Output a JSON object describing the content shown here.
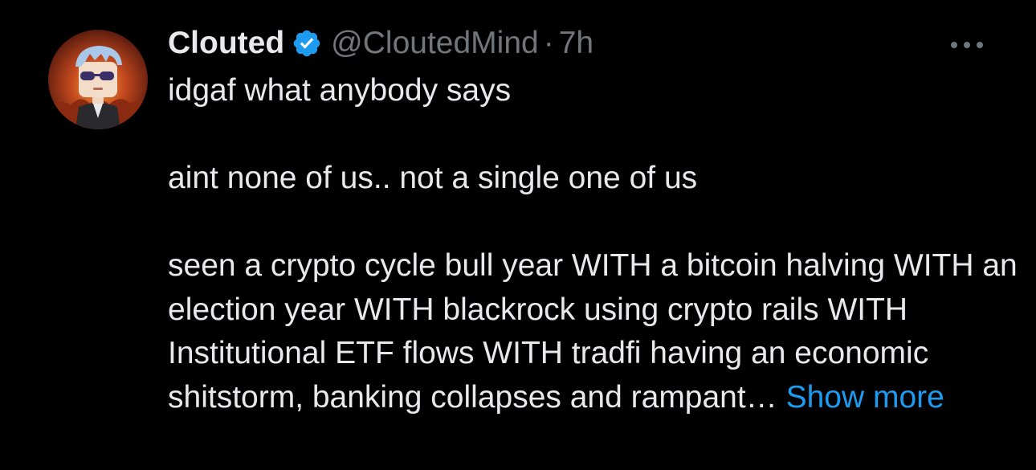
{
  "tweet": {
    "author": {
      "display_name": "Clouted",
      "handle": "@CloutedMind",
      "verified": true,
      "avatar_icon": "avatar-cartoon-character-icon"
    },
    "separator": "·",
    "timestamp": "7h",
    "more_icon": "more-horizontal-icon",
    "text": {
      "line1": "idgaf what anybody says",
      "line2": "aint none of us.. not a single one of us",
      "paragraph3": "seen a crypto cycle bull year WITH a bitcoin halving WITH an election year WITH blackrock using crypto rails WITH Institutional ETF flows WITH tradfi having an economic shitstorm, banking collapses and rampant…"
    },
    "show_more_label": "Show more"
  },
  "colors": {
    "background": "#000000",
    "primary_text": "#e7e9ea",
    "secondary_text": "#71767b",
    "link": "#1d9bf0",
    "verified": "#1d9bf0"
  }
}
